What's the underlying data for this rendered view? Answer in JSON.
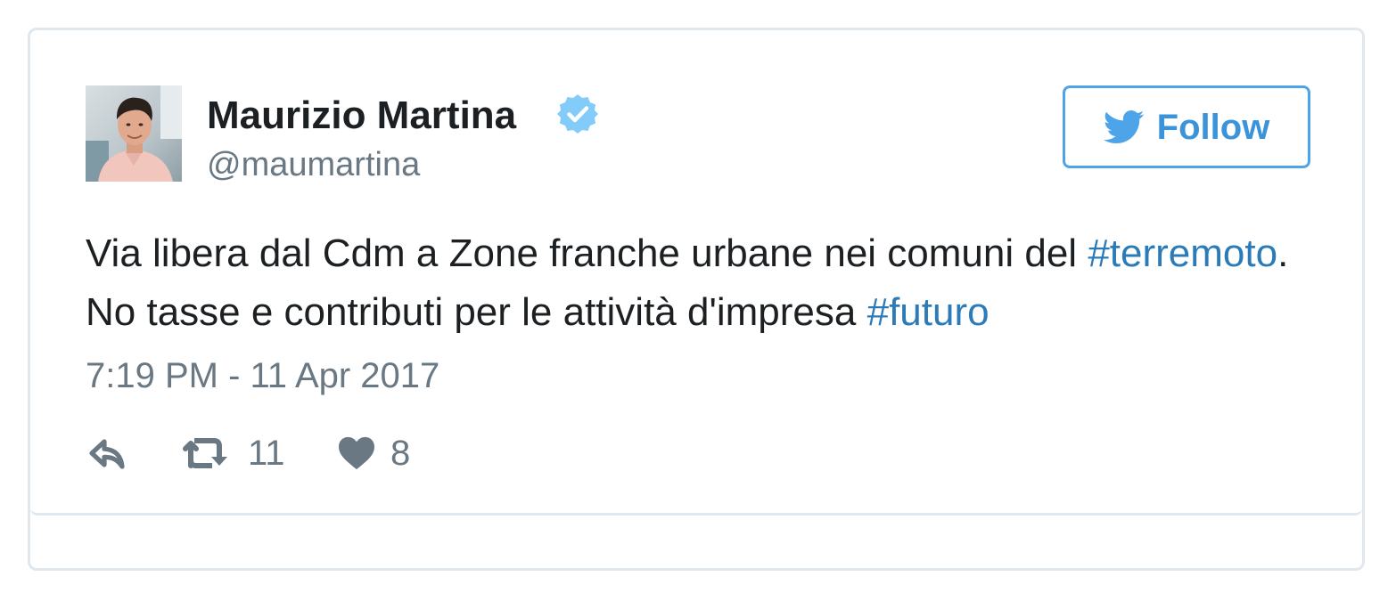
{
  "tweet": {
    "author": {
      "display_name": "Maurizio Martina",
      "handle": "@maumartina",
      "verified": true
    },
    "follow_button": {
      "label": "Follow",
      "icon": "twitter-bird-icon"
    },
    "text": {
      "before_tag1": "Via libera dal Cdm a Zone franche urbane nei comuni del ",
      "hashtag1": "#terremoto",
      "middle": ". No tasse e contributi per le attività d'impresa ",
      "hashtag2": "#futuro"
    },
    "timestamp": "7:19 PM - 11 Apr 2017",
    "actions": {
      "reply_icon": "reply-icon",
      "retweet_icon": "retweet-icon",
      "retweet_count": "11",
      "like_icon": "heart-icon",
      "like_count": "8"
    }
  },
  "colors": {
    "text_primary": "#1c2022",
    "text_secondary": "#697882",
    "link": "#2b7bb9",
    "accent": "#3b94d9",
    "verified": "#1da1f2",
    "border": "#e1e8ed"
  }
}
